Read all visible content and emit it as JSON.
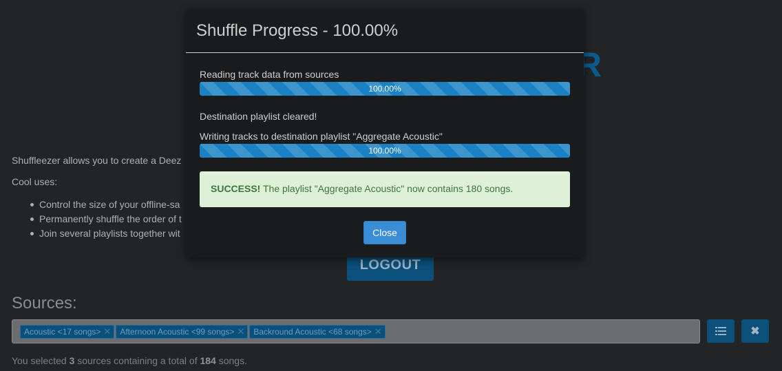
{
  "background": {
    "title_fragment": "R",
    "intro_text": "Shuffleezer allows you to create a Deez",
    "cool_uses_label": "Cool uses:",
    "uses": [
      "Control the size of your offline-sa",
      "Permanently shuffle the order of t",
      "Join several playlists together wit"
    ],
    "logout_label": "LOGOUT",
    "sources_heading": "Sources:",
    "sources": [
      "Acoustic <17 songs>",
      "Afternoon Acoustic <99 songs>",
      "Backround Acoustic <68 songs>"
    ],
    "tag_remove_glyph": "✕",
    "summary": {
      "prefix": "You selected ",
      "count": "3",
      "middle": " sources containing a total of ",
      "total": "184",
      "suffix": " songs."
    }
  },
  "modal": {
    "title": "Shuffle Progress - 100.00%",
    "steps": [
      {
        "label": "Reading track data from sources",
        "progress_label": "100.00%",
        "progress": 100
      },
      {
        "label": "Writing tracks to destination playlist \"Aggregate Acoustic\"",
        "progress_label": "100.00%",
        "progress": 100
      }
    ],
    "cleared_text": "Destination playlist cleared!",
    "alert": {
      "strong": "SUCCESS!",
      "message": " The playlist \"Aggregate Acoustic\" now contains 180 songs."
    },
    "close_label": "Close"
  },
  "colors": {
    "accent": "#1a82c4",
    "success_bg": "#dff0d8",
    "success_text": "#3c763d",
    "button_primary": "#3a8dd4"
  },
  "icons": {
    "list_button": "list-icon",
    "clear_button": "close-icon"
  }
}
